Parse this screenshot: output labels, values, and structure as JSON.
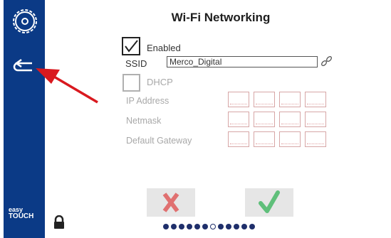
{
  "header": {
    "title": "Wi-Fi Networking"
  },
  "sidebar": {
    "brand_line1": "easy",
    "brand_line2": "TOUCH",
    "icons": [
      "gear-icon",
      "back-arrow-icon"
    ]
  },
  "form": {
    "enabled_label": "Enabled",
    "enabled_checked": true,
    "ssid_label": "SSID",
    "ssid_value": "Merco_Digital",
    "dhcp_label": "DHCP",
    "dhcp_checked": false,
    "ip_address_label": "IP Address",
    "netmask_label": "Netmask",
    "gateway_label": "Default Gateway"
  },
  "footer": {
    "cancel_icon": "x-icon",
    "ok_icon": "check-icon",
    "lock_icon": "lock-icon",
    "page_count": 12,
    "current_page_index": 6
  },
  "colors": {
    "sidebar": "#0b3a86",
    "cancel_x": "#e07070",
    "ok_check": "#5fbf7a",
    "annotation_arrow": "#d9191f"
  }
}
